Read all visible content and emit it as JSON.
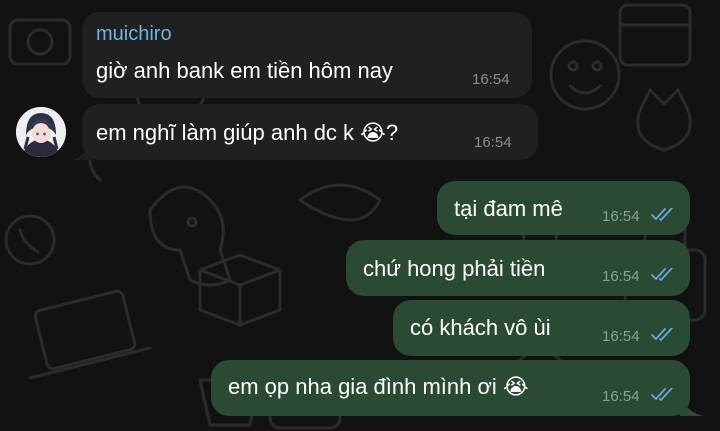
{
  "messages": [
    {
      "direction": "in",
      "sender": "muichiro",
      "text": "giờ anh bank em tiền hôm nay",
      "time": "16:54"
    },
    {
      "direction": "in",
      "text": "em nghĩ làm giúp anh dc k",
      "emoji": "😭",
      "tail_text": "?",
      "time": "16:54",
      "has_avatar": true
    },
    {
      "direction": "out",
      "text": "tại đam mê",
      "time": "16:54",
      "read": true
    },
    {
      "direction": "out",
      "text": "chứ hong phải tiền",
      "time": "16:54",
      "read": true
    },
    {
      "direction": "out",
      "text": "có khách vô ùi",
      "time": "16:54",
      "read": true
    },
    {
      "direction": "out",
      "text": "em ọp nha gia đình mình ơi",
      "emoji": "😭",
      "time": "16:54",
      "read": true
    }
  ],
  "icons": {
    "read_receipt": "double-check-icon",
    "crying_emoji": "loudly-crying-face-emoji"
  },
  "colors": {
    "background": "#121212",
    "incoming_bubble": "#202020",
    "outgoing_bubble": "#2b4a33",
    "sender_name": "#6fb4e0",
    "read_tick": "#6aa5df"
  }
}
